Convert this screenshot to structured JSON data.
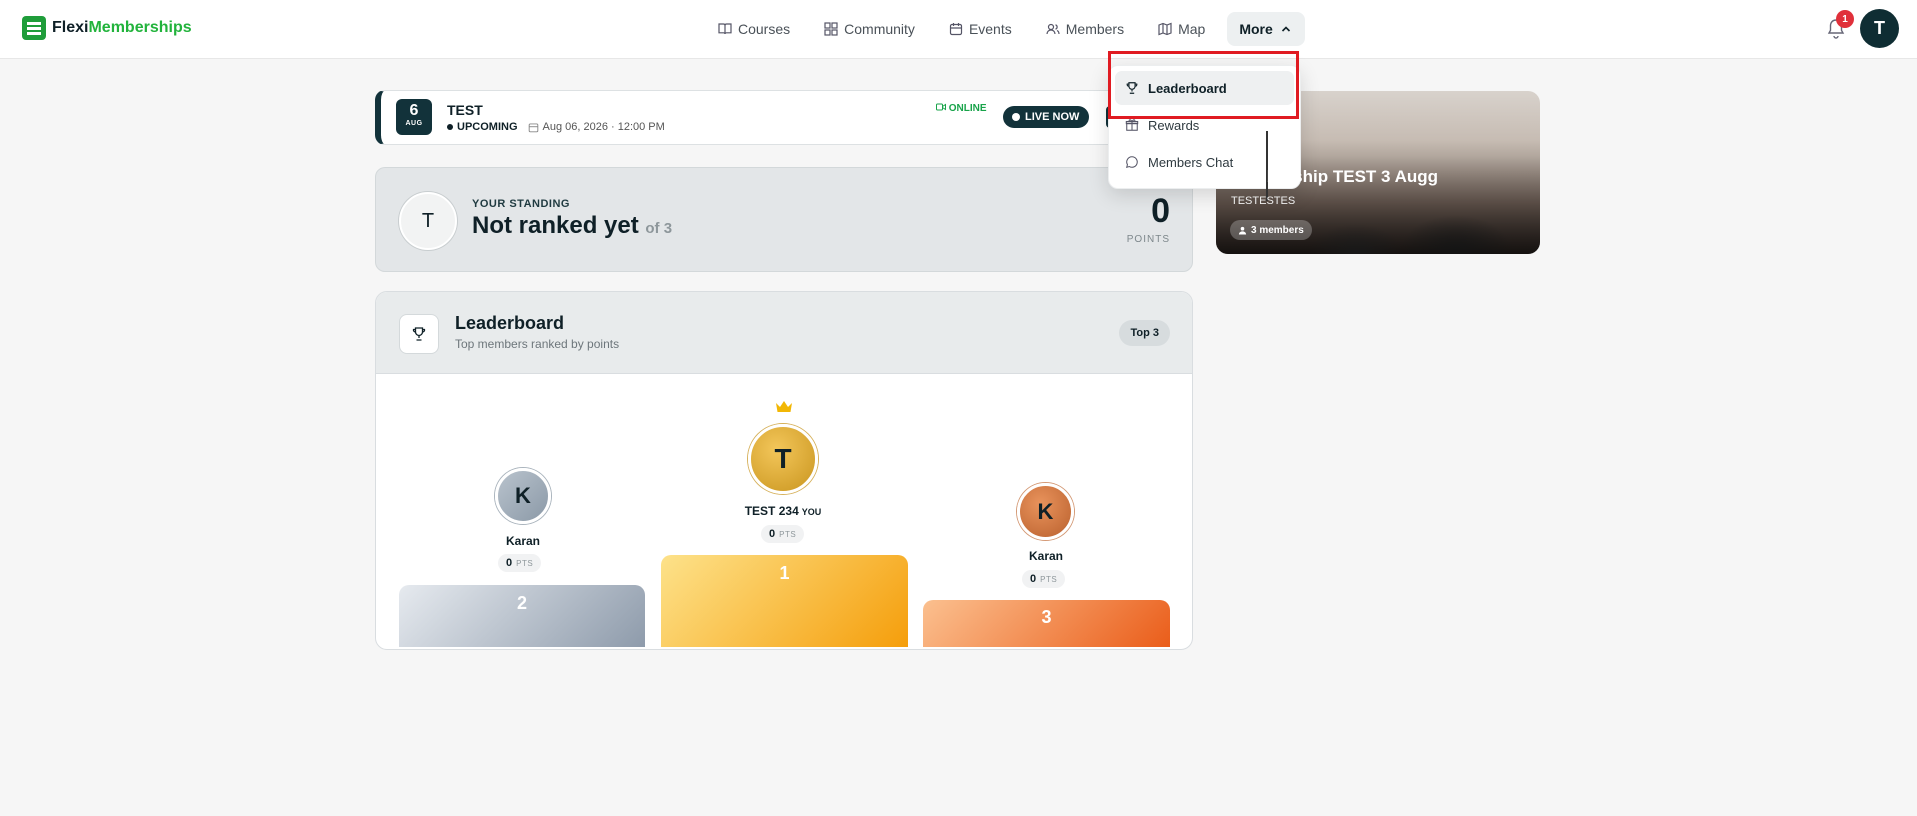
{
  "header": {
    "brand_part1": "Flexi",
    "brand_part2": "Memberships",
    "nav": [
      {
        "label": "Courses",
        "icon": "book-icon"
      },
      {
        "label": "Community",
        "icon": "grid-icon"
      },
      {
        "label": "Events",
        "icon": "calendar-icon"
      },
      {
        "label": "Members",
        "icon": "users-icon"
      },
      {
        "label": "Map",
        "icon": "map-icon"
      },
      {
        "label": "More",
        "icon": "chevron-up-icon"
      }
    ],
    "notification_count": "1",
    "user_initial": "T"
  },
  "event": {
    "day": "6",
    "month": "AUG",
    "title": "TEST",
    "status": "UPCOMING",
    "datetime": "Aug 06, 2026 · 12:00 PM",
    "mode": "ONLINE",
    "live_label": "LIVE NOW"
  },
  "standing": {
    "label": "YOUR STANDING",
    "initial": "T",
    "value": "Not ranked yet",
    "of": "of 3",
    "points": "0",
    "points_label": "POINTS"
  },
  "leaderboard": {
    "title": "Leaderboard",
    "subtitle": "Top members ranked by points",
    "badge": "Top 3",
    "podium": [
      {
        "rank": "2",
        "initial": "K",
        "name": "Karan",
        "points": "0",
        "unit": "PTS"
      },
      {
        "rank": "1",
        "initial": "T",
        "name": "TEST 234",
        "you": "YOU",
        "points": "0",
        "unit": "PTS"
      },
      {
        "rank": "3",
        "initial": "K",
        "name": "Karan",
        "points": "0",
        "unit": "PTS"
      }
    ]
  },
  "group": {
    "title": "Membership TEST 3 Augg",
    "subtitle": "TESTESTES",
    "members": "3 members"
  },
  "more_menu": {
    "items": [
      {
        "label": "Leaderboard",
        "icon": "trophy-icon"
      },
      {
        "label": "Rewards",
        "icon": "gift-icon"
      },
      {
        "label": "Members Chat",
        "icon": "chat-icon"
      }
    ]
  }
}
